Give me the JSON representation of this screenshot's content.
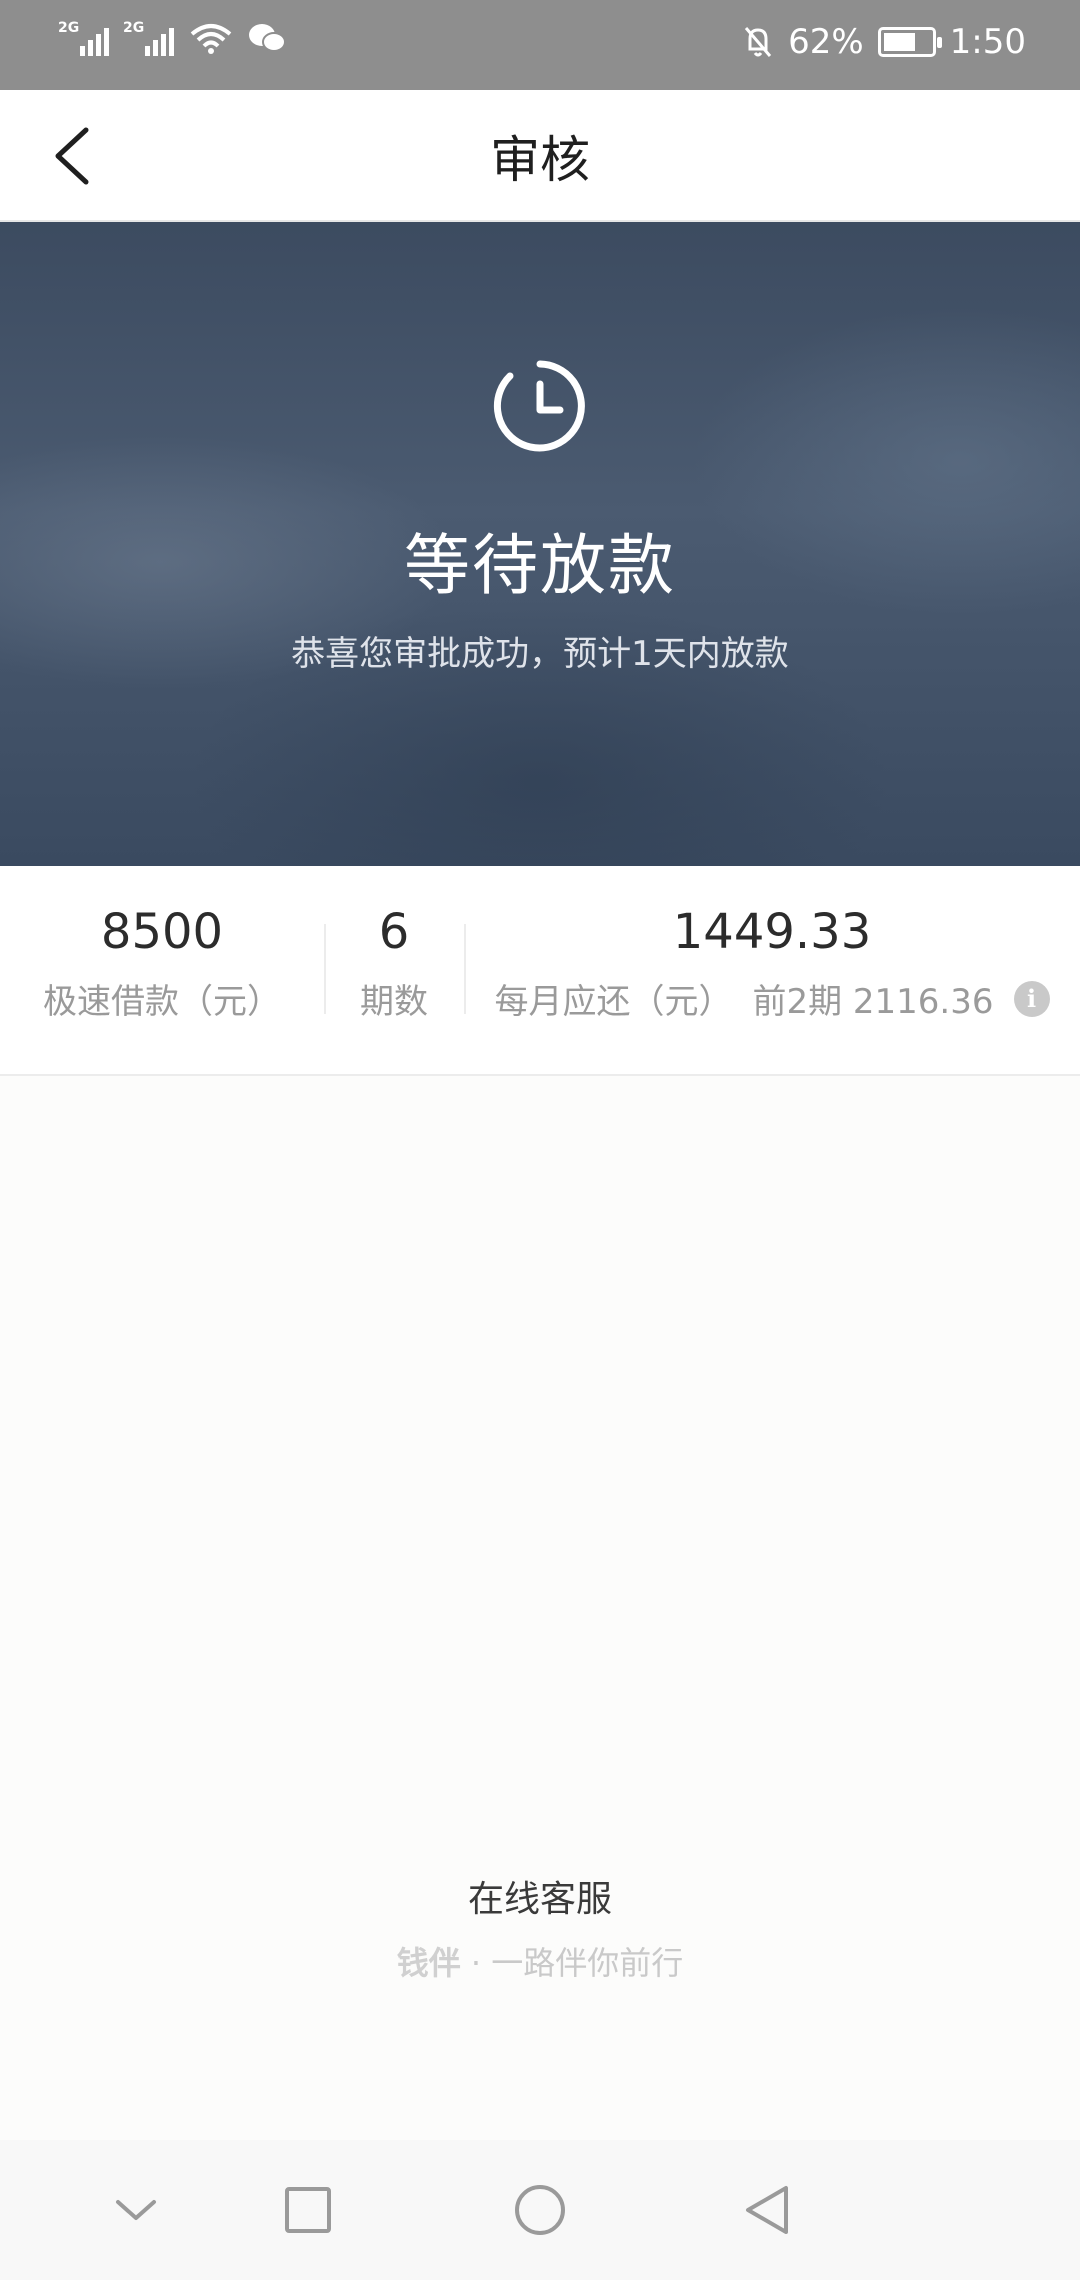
{
  "status_bar": {
    "signal1_tag": "2G",
    "signal2_tag": "2G",
    "battery_percent": "62%",
    "time": "1:50"
  },
  "header": {
    "title": "审核"
  },
  "banner": {
    "status": "等待放款",
    "subtitle": "恭喜您审批成功，预计1天内放款"
  },
  "summary": {
    "amount": {
      "value": "8500",
      "label": "极速借款（元）"
    },
    "periods": {
      "value": "6",
      "label": "期数"
    },
    "monthly": {
      "value": "1449.33",
      "label": "每月应还（元）",
      "note": "前2期 2116.36",
      "info_icon": "i"
    }
  },
  "footer": {
    "service": "在线客服",
    "brand": "钱伴",
    "separator": "·",
    "slogan": "一路伴你前行"
  },
  "colors": {
    "banner": "#46566c",
    "status_bar": "#8e8e8e"
  }
}
